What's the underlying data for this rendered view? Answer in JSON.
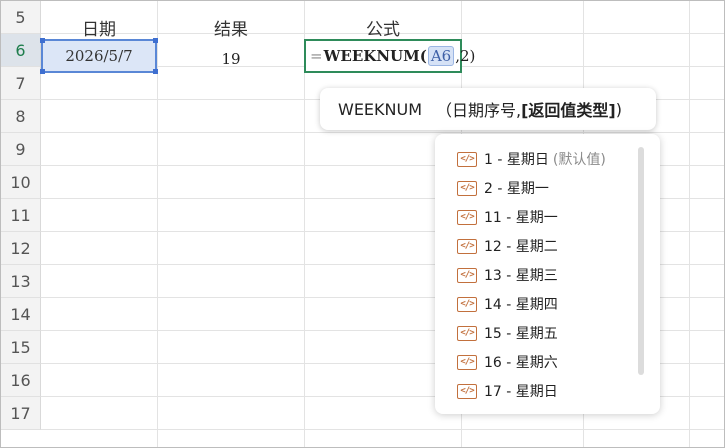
{
  "rows": [
    "5",
    "6",
    "7",
    "8",
    "9",
    "10",
    "11",
    "12",
    "13",
    "14",
    "15",
    "16",
    "17"
  ],
  "headers": {
    "a": "日期",
    "b": "结果",
    "c": "公式"
  },
  "row6": {
    "a": "2026/5/7",
    "b": "19"
  },
  "formula": {
    "eq": "=",
    "fn": "WEEKNUM(",
    "ref": "A6",
    "rest": ",2)"
  },
  "tooltip": {
    "fn": "WEEKNUM",
    "open": "（日期序号,",
    "param": "[返回值类型]",
    "close": ")"
  },
  "options": [
    {
      "label": "1 - 星期日",
      "note": "(默认值)"
    },
    {
      "label": "2 - 星期一",
      "note": ""
    },
    {
      "label": "11 - 星期一",
      "note": ""
    },
    {
      "label": "12 - 星期二",
      "note": ""
    },
    {
      "label": "13 - 星期三",
      "note": ""
    },
    {
      "label": "14 - 星期四",
      "note": ""
    },
    {
      "label": "15 - 星期五",
      "note": ""
    },
    {
      "label": "16 - 星期六",
      "note": ""
    },
    {
      "label": "17 - 星期日",
      "note": ""
    }
  ],
  "icons": {
    "option": "function-code-icon"
  },
  "colors": {
    "active_border": "#2e8b5a",
    "ref_border": "#5a87d6",
    "icon": "#c2703d"
  }
}
